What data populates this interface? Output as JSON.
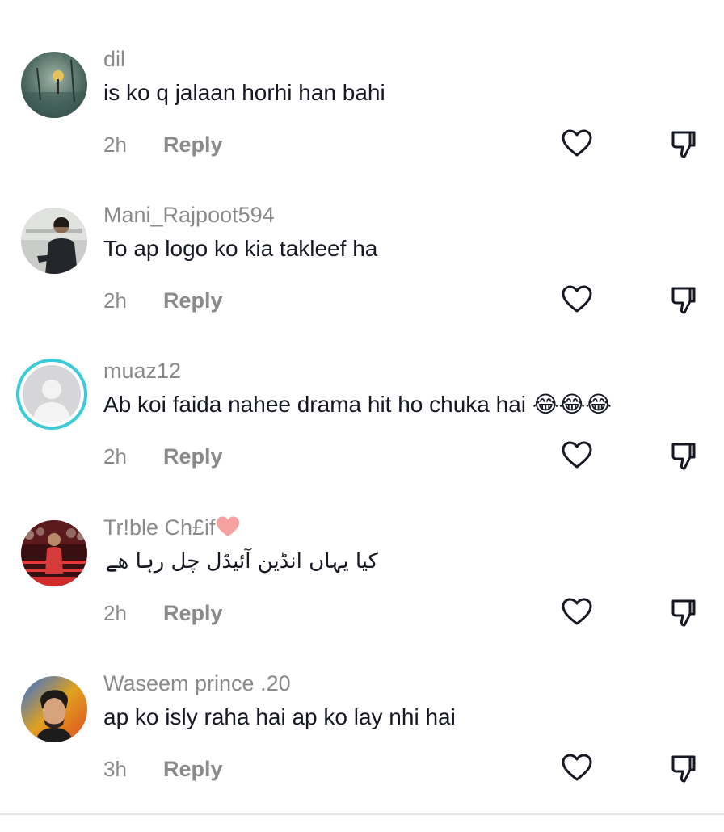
{
  "comments": [
    {
      "username": "dil",
      "text": "is ko q jalaan horhi han bahi",
      "time": "2h",
      "reply_label": "Reply",
      "avatar": "photo-avatar-scenic"
    },
    {
      "username": "Mani_Rajpoot594",
      "text": "To ap logo ko kia takleef ha",
      "time": "2h",
      "reply_label": "Reply",
      "avatar": "photo-avatar-man"
    },
    {
      "username": "muaz12",
      "text": "Ab koi faida nahee drama hit ho chuka hai",
      "emoji": "😂😂😂",
      "time": "2h",
      "reply_label": "Reply",
      "avatar": "default-avatar"
    },
    {
      "username": "Tr!ble Ch£if",
      "username_emoji": "heart-emoji",
      "text": "کیا یہاں انڈین آئیڈل چل رہا ھے",
      "time": "2h",
      "reply_label": "Reply",
      "avatar": "photo-avatar-stage"
    },
    {
      "username": "Waseem prince .20",
      "text": "ap ko isly raha hai ap ko lay nhi hai",
      "time": "3h",
      "reply_label": "Reply",
      "avatar": "photo-avatar-portrait"
    }
  ],
  "icons": {
    "like": "heart-outline-icon",
    "dislike": "thumbs-down-outline-icon"
  },
  "colors": {
    "text": "#161823",
    "secondary": "#8a8a8a",
    "icon": "#161823",
    "avatar_ring": "#3ccbd8",
    "heart_emoji": "#f7a0a0"
  }
}
